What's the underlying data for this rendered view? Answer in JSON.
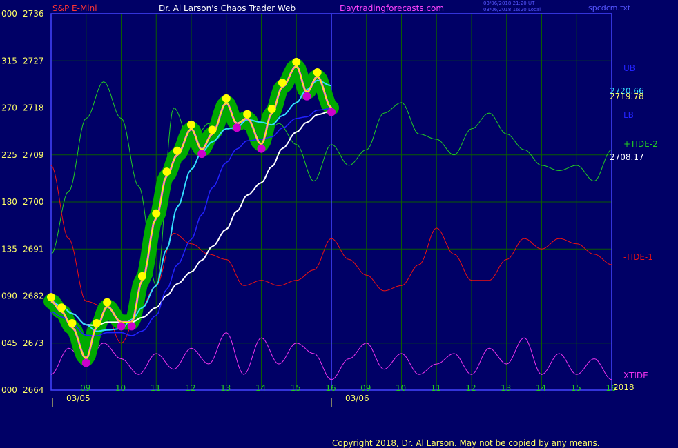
{
  "header": {
    "symbol": "S&P E-Mini",
    "title": "Dr. Al Larson's Chaos Trader Web",
    "site": "Daytradingforecasts.com",
    "timestamp_ut": "03/06/2018 21:20 UT",
    "timestamp_local": "03/06/2018 16:20 Local",
    "file": "spcdcm.txt"
  },
  "footer": {
    "copyright": "Copyright 2018, Dr. Al Larson. May not be copied by any means."
  },
  "colors": {
    "background": "#000066",
    "grid": "#0a5c00",
    "frame": "#4444ff",
    "price": "#ffff00",
    "price_bright": "#ffffff",
    "band": "#00aa00",
    "dot": "#ffff00",
    "dot_low": "#cc00cc",
    "ma_fast": "#ff44ff",
    "ma_mid": "#33ddff",
    "ma_slow": "#ffffff",
    "band_line": "#2222ff",
    "tide2": "#22cc22",
    "tide1": "#ee1111",
    "xtide": "#ee33ee",
    "axis_text": "#ffff66",
    "tick_text": "#22cc22"
  },
  "chart_data": {
    "type": "line",
    "left_axis_labels": [
      "000",
      "045",
      "090",
      "135",
      "180",
      "225",
      "270",
      "315",
      "000"
    ],
    "price_labels": [
      "2664",
      "2673",
      "2682",
      "2691",
      "2700",
      "2709",
      "2718",
      "2727",
      "2736"
    ],
    "ylim": [
      2664,
      2736
    ],
    "x_ticks": [
      "09",
      "10",
      "11",
      "12",
      "13",
      "14",
      "15",
      "16",
      "09",
      "10",
      "11",
      "12",
      "13",
      "14",
      "15",
      "16"
    ],
    "dates": [
      "03/05",
      "03/06"
    ],
    "year": "2018",
    "right_labels": {
      "ub": "UB",
      "lb": "LB",
      "tide2": "+TIDE-2",
      "tide1": "-TIDE-1",
      "xtide": "XTIDE",
      "value_upper": "2720.66",
      "value_lower": "2719.78",
      "value_tide": "2708.17"
    },
    "series": [
      {
        "name": "S&P E-Mini",
        "x": [
          8.0,
          8.3,
          8.6,
          9.0,
          9.3,
          9.6,
          10.0,
          10.3,
          10.6,
          11.0,
          11.3,
          11.6,
          12.0,
          12.3,
          12.6,
          13.0,
          13.3,
          13.6,
          14.0,
          14.3,
          14.6,
          15.0,
          15.3,
          15.6,
          16.0
        ],
        "values": [
          2681,
          2679,
          2676,
          2670,
          2676,
          2680,
          2677,
          2677,
          2685,
          2697,
          2705,
          2709,
          2714,
          2710,
          2713,
          2719,
          2715,
          2716,
          2711,
          2717,
          2722,
          2726,
          2721,
          2724,
          2718
        ]
      },
      {
        "name": "+TIDE-2",
        "x": [
          8.0,
          8.5,
          9.0,
          9.5,
          10.0,
          10.5,
          11.0,
          11.5,
          12.0,
          12.5,
          13.0,
          13.5,
          14.0,
          14.5,
          15.0,
          15.5,
          16.0,
          16.5,
          17.0,
          17.5,
          18.0,
          18.5,
          19.0,
          19.5,
          20.0,
          20.5,
          21.0,
          21.5,
          22.0,
          22.5,
          23.0,
          23.5,
          24.0
        ],
        "values": [
          2690,
          2702,
          2716,
          2723,
          2716,
          2703,
          2684,
          2718,
          2711,
          2715,
          2717,
          2714,
          2711,
          2715,
          2711,
          2704,
          2711,
          2707,
          2710,
          2717,
          2719,
          2713,
          2712,
          2709,
          2714,
          2717,
          2713,
          2710,
          2707,
          2706,
          2707,
          2704,
          2710
        ]
      },
      {
        "name": "-TIDE-1",
        "x": [
          8.0,
          8.5,
          9.0,
          9.5,
          10.0,
          10.5,
          11.0,
          11.5,
          12.0,
          12.5,
          13.0,
          13.5,
          14.0,
          14.5,
          15.0,
          15.5,
          16.0,
          16.5,
          17.0,
          17.5,
          18.0,
          18.5,
          19.0,
          19.5,
          20.0,
          20.5,
          21.0,
          21.5,
          22.0,
          22.5,
          23.0,
          23.5,
          24.0
        ],
        "values": [
          2707,
          2693,
          2681,
          2680,
          2673,
          2679,
          2684,
          2694,
          2692,
          2690,
          2689,
          2684,
          2685,
          2684,
          2685,
          2687,
          2693,
          2689,
          2686,
          2683,
          2684,
          2688,
          2695,
          2690,
          2685,
          2685,
          2689,
          2693,
          2691,
          2693,
          2692,
          2690,
          2688
        ]
      },
      {
        "name": "XTIDE",
        "x": [
          8.0,
          8.5,
          9.0,
          9.5,
          10.0,
          10.5,
          11.0,
          11.5,
          12.0,
          12.5,
          13.0,
          13.5,
          14.0,
          14.5,
          15.0,
          15.5,
          16.0,
          16.5,
          17.0,
          17.5,
          18.0,
          18.5,
          19.0,
          19.5,
          20.0,
          20.5,
          21.0,
          21.5,
          22.0,
          22.5,
          23.0,
          23.5,
          24.0
        ],
        "values": [
          2667,
          2672,
          2669,
          2673,
          2670,
          2667,
          2671,
          2668,
          2672,
          2669,
          2675,
          2667,
          2674,
          2669,
          2673,
          2671,
          2666,
          2670,
          2673,
          2668,
          2671,
          2667,
          2669,
          2671,
          2667,
          2672,
          2669,
          2674,
          2667,
          2671,
          2667,
          2670,
          2666
        ]
      }
    ],
    "grid": true
  }
}
